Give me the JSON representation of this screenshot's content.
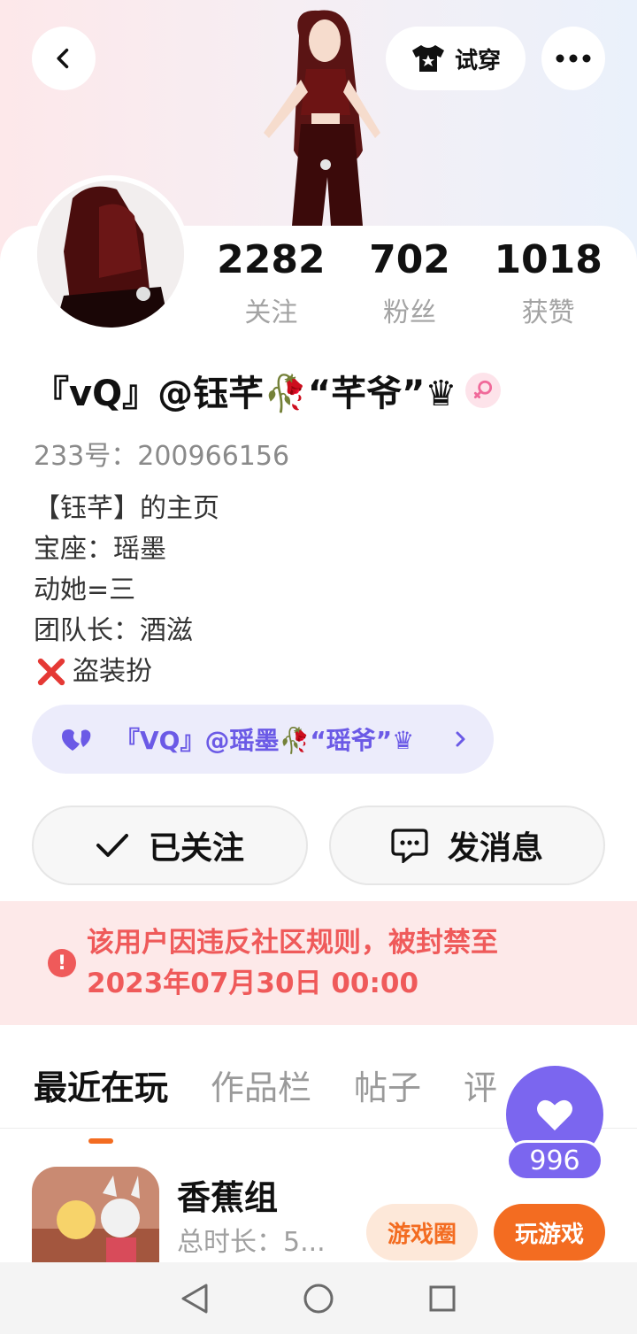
{
  "header": {
    "tryon_label": "试穿"
  },
  "stats": [
    {
      "value": "2282",
      "label": "关注"
    },
    {
      "value": "702",
      "label": "粉丝"
    },
    {
      "value": "1018",
      "label": "获赞"
    }
  ],
  "profile": {
    "nickname": "『vQ』@钰芊🥀“芊爷”♛",
    "uid": "233号：200966156",
    "bio": [
      "【钰芊】的主页",
      "宝座：瑶墨",
      "动她=三",
      "团队长：酒滋",
      "盗装扮"
    ]
  },
  "cp": {
    "label": "『VQ』@瑶墨🥀“瑶爷”♛"
  },
  "actions": {
    "follow_label": "已关注",
    "message_label": "发消息"
  },
  "ban": {
    "line1": "该用户因违反社区规则，被封禁至",
    "line2": "2023年07月30日 00:00"
  },
  "tabs": [
    "最近在玩",
    "作品栏",
    "帖子",
    "评"
  ],
  "like": {
    "count": "996"
  },
  "game": {
    "name": "香蕉组",
    "time": "总时长：5...",
    "circle_label": "游戏圈",
    "play_label": "玩游戏"
  },
  "colors": {
    "accent": "#f36c21",
    "purple": "#7b66ef",
    "ban_red": "#ef5a5a"
  },
  "icons": [
    "back-icon",
    "tshirt-icon",
    "more-icon",
    "female-icon",
    "x-mark-icon",
    "heart-icon",
    "chevron-right-icon",
    "check-icon",
    "chat-icon",
    "alert-icon",
    "nav-back-icon",
    "nav-home-icon",
    "nav-recent-icon"
  ]
}
